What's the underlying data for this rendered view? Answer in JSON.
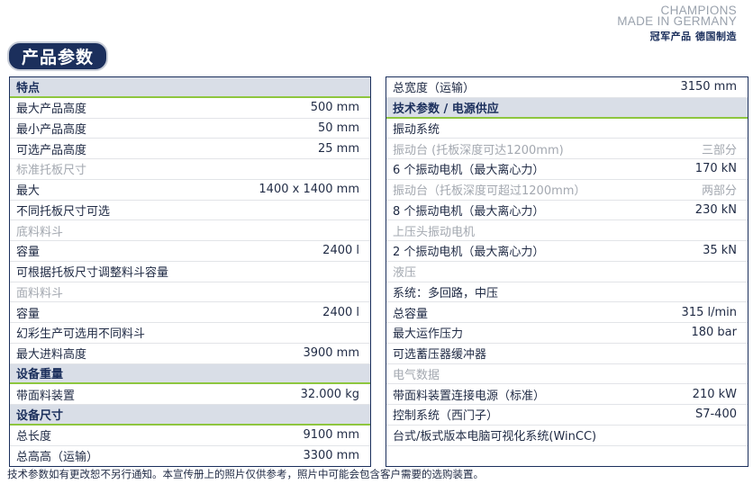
{
  "brand": {
    "line1": "CHAMPIONS",
    "line2": "MADE IN GERMANY",
    "cn": "冠军产品 德国制造"
  },
  "title": "产品参数",
  "left_rows": [
    {
      "type": "header",
      "label": "特点",
      "value": ""
    },
    {
      "type": "row",
      "label": "最大产品高度",
      "value": "500 mm"
    },
    {
      "type": "row",
      "label": "最小产品高度",
      "value": "50 mm"
    },
    {
      "type": "row",
      "label": "可选产品高度",
      "value": "25 mm"
    },
    {
      "type": "sub",
      "label": "标准托板尺寸",
      "value": ""
    },
    {
      "type": "row",
      "label": "最大",
      "value": "1400 x 1400 mm"
    },
    {
      "type": "row",
      "label": "不同托板尺寸可选",
      "value": ""
    },
    {
      "type": "sub",
      "label": "底料料斗",
      "value": ""
    },
    {
      "type": "row",
      "label": "容量",
      "value": "2400 l"
    },
    {
      "type": "row",
      "label": "可根据托板尺寸调整料斗容量",
      "value": ""
    },
    {
      "type": "sub",
      "label": "面料料斗",
      "value": ""
    },
    {
      "type": "row",
      "label": "容量",
      "value": "2400 l"
    },
    {
      "type": "row",
      "label": "幻彩生产可选用不同料斗",
      "value": ""
    },
    {
      "type": "row",
      "label": "最大进料高度",
      "value": "3900 mm"
    },
    {
      "type": "header",
      "label": "设备重量",
      "value": ""
    },
    {
      "type": "row",
      "label": "带面料装置",
      "value": "32.000 kg"
    },
    {
      "type": "header",
      "label": "设备尺寸",
      "value": ""
    },
    {
      "type": "row",
      "label": "总长度",
      "value": "9100 mm"
    },
    {
      "type": "row",
      "label": "总高高（运输）",
      "value": "3300 mm"
    }
  ],
  "right_rows": [
    {
      "type": "row",
      "label": "总宽度（运输）",
      "value": "3150 mm"
    },
    {
      "type": "header",
      "label": "技术参数 / 电源供应",
      "value": ""
    },
    {
      "type": "row",
      "label": "振动系统",
      "value": ""
    },
    {
      "type": "sub",
      "label": "振动台 (托板深度可达1200mm)",
      "value": "三部分"
    },
    {
      "type": "row",
      "label": "6 个振动电机（最大离心力）",
      "value": "170 kN"
    },
    {
      "type": "sub",
      "label": "振动台（托板深度可超过1200mm）",
      "value": "两部分"
    },
    {
      "type": "row",
      "label": "8 个振动电机（最大离心力）",
      "value": "230 kN"
    },
    {
      "type": "sub",
      "label": "上压头振动电机",
      "value": ""
    },
    {
      "type": "row",
      "label": "2 个振动电机（最大离心力）",
      "value": "35 kN"
    },
    {
      "type": "sub",
      "label": "液压",
      "value": ""
    },
    {
      "type": "row",
      "label": "系统：多回路，中压",
      "value": ""
    },
    {
      "type": "row",
      "label": "总容量",
      "value": "315 l/min"
    },
    {
      "type": "row",
      "label": "最大运作压力",
      "value": "180 bar"
    },
    {
      "type": "row",
      "label": "可选蓄压器缓冲器",
      "value": ""
    },
    {
      "type": "sub",
      "label": "电气数据",
      "value": ""
    },
    {
      "type": "row",
      "label": "带面料装置连接电源（标准）",
      "value": "210 kW"
    },
    {
      "type": "row",
      "label": "控制系统（西门子）",
      "value": "S7-400"
    },
    {
      "type": "row",
      "label": "台式/板式版本电脑可视化系统(WinCC)",
      "value": ""
    },
    {
      "type": "row",
      "label": "",
      "value": ""
    }
  ],
  "footnote": "技术参数如有更改恕不另行通知。本宣传册上的照片仅供参考，照片中可能会包含客户需要的选购装置。"
}
